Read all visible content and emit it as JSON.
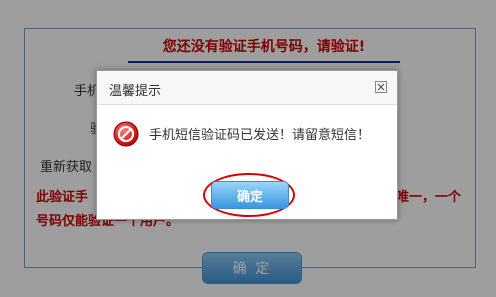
{
  "page": {
    "heading": "您还没有验证手机号码，请验证!",
    "label_phone_partial": "手机",
    "label_code_partial": "验",
    "label_resend_partial": "重新获取",
    "warning_line1_left": "此验证手",
    "warning_line1_right": "唯一，一个",
    "warning_line2": "号码仅能验证一个用户。",
    "confirm_label": "确  定"
  },
  "dialog": {
    "title": "温馨提示",
    "message": "手机短信验证码已发送！请留意短信！",
    "ok_label": "确定"
  },
  "colors": {
    "heading_red": "#cc0000",
    "highlight_circle": "#d80000",
    "button_blue": "#3896e0"
  },
  "icons": {
    "close": "close-x-icon",
    "status": "stop-icon"
  }
}
